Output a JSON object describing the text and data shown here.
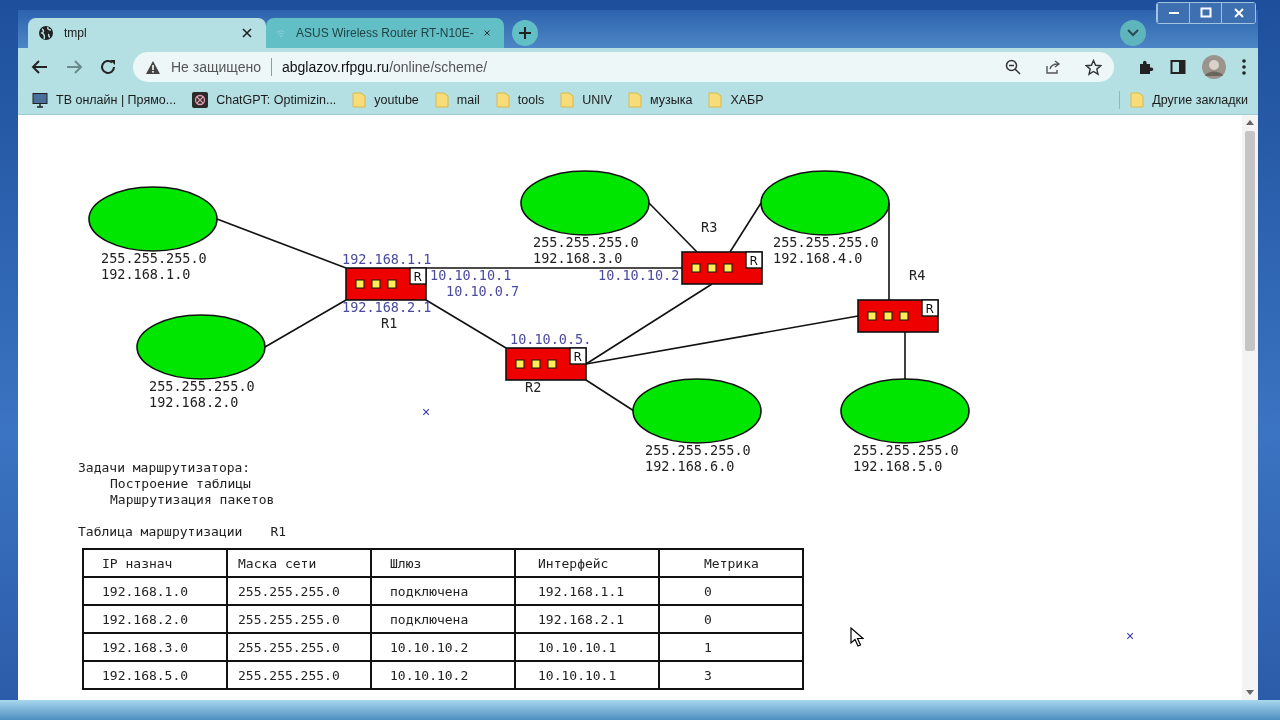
{
  "tabs": [
    {
      "title": "tmpl",
      "selected": true
    },
    {
      "title": "ASUS Wireless Router RT-N10E-",
      "selected": false
    }
  ],
  "address_bar": {
    "security": "Не защищено",
    "host": "abglazov.rfpgu.ru",
    "path": "/online/scheme/"
  },
  "bookmarks": [
    {
      "kind": "tv",
      "label": "ТВ онлайн | Прямо..."
    },
    {
      "kind": "spiral",
      "label": "ChatGPT: Optimizin..."
    },
    {
      "kind": "folder",
      "label": "youtube"
    },
    {
      "kind": "folder",
      "label": "mail"
    },
    {
      "kind": "folder",
      "label": "tools"
    },
    {
      "kind": "folder",
      "label": "UNIV"
    },
    {
      "kind": "folder",
      "label": "музыка"
    },
    {
      "kind": "folder",
      "label": "ХАБР"
    }
  ],
  "other_bookmarks": "Другие закладки",
  "diagram": {
    "networks": [
      {
        "mask": "255.255.255.0",
        "address": "192.168.1.0"
      },
      {
        "mask": "255.255.255.0",
        "address": "192.168.2.0"
      },
      {
        "mask": "255.255.255.0",
        "address": "192.168.3.0"
      },
      {
        "mask": "255.255.255.0",
        "address": "192.168.4.0"
      },
      {
        "mask": "255.255.255.0",
        "address": "192.168.6.0"
      },
      {
        "mask": "255.255.255.0",
        "address": "192.168.5.0"
      }
    ],
    "routers": [
      {
        "name": "R1",
        "badge": "R",
        "interfaces": [
          "192.168.1.1",
          "10.10.10.1",
          "10.10.0.7",
          "192.168.2.1"
        ]
      },
      {
        "name": "R2",
        "badge": "R",
        "interfaces": [
          "10.10.0.5."
        ]
      },
      {
        "name": "R3",
        "badge": "R",
        "interfaces": [
          "10.10.10.2"
        ]
      },
      {
        "name": "R4",
        "badge": "R"
      }
    ]
  },
  "marks": [
    "×",
    "×"
  ],
  "tasks": {
    "title": "Задачи маршрутизатора:",
    "items": [
      "Построение таблицы",
      "Маршрутизация пакетов"
    ]
  },
  "routing_table": {
    "caption": "Таблица маршрутизации",
    "router": "R1",
    "columns": [
      "IP назнач",
      "Маска сети",
      "Шлюз",
      "Интерфейс",
      "Метрика"
    ],
    "rows": [
      [
        "192.168.1.0",
        "255.255.255.0",
        "подключена",
        "192.168.1.1",
        "0"
      ],
      [
        "192.168.2.0",
        "255.255.255.0",
        "подключена",
        "192.168.2.1",
        "0"
      ],
      [
        "192.168.3.0",
        "255.255.255.0",
        "10.10.10.2",
        "10.10.10.1",
        "1"
      ],
      [
        "192.168.5.0",
        "255.255.255.0",
        "10.10.10.2",
        "10.10.10.1",
        "3"
      ]
    ]
  }
}
